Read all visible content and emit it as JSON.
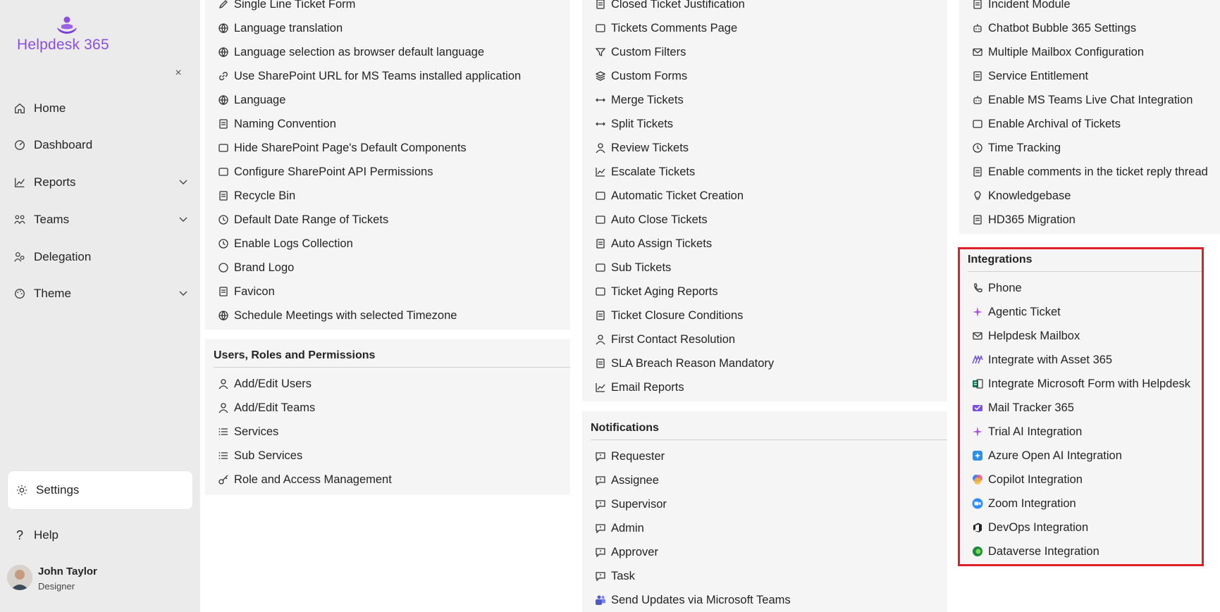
{
  "app": {
    "name": "Helpdesk 365"
  },
  "sidebar": {
    "close_label": "×",
    "nav": [
      {
        "label": "Home",
        "icon": "home-icon"
      },
      {
        "label": "Dashboard",
        "icon": "dashboard-icon"
      },
      {
        "label": "Reports",
        "icon": "chart-icon",
        "expandable": true
      },
      {
        "label": "Teams",
        "icon": "teams-icon",
        "expandable": true
      },
      {
        "label": "Delegation",
        "icon": "delegation-icon"
      },
      {
        "label": "Theme",
        "icon": "theme-icon",
        "expandable": true
      }
    ],
    "settings_label": "Settings",
    "help_label": "Help",
    "user": {
      "name": "John Taylor",
      "role": "Designer"
    }
  },
  "columns": {
    "col1_top": [
      "Single Line Ticket Form",
      "Language translation",
      "Language selection as browser default language",
      "Use SharePoint URL for MS Teams installed application",
      "Language",
      "Naming Convention",
      "Hide SharePoint Page's Default Components",
      "Configure SharePoint API Permissions",
      "Recycle Bin",
      "Default Date Range of Tickets",
      "Enable Logs Collection",
      "Brand Logo",
      "Favicon",
      "Schedule Meetings with selected Timezone"
    ],
    "users_roles": {
      "title": "Users, Roles and Permissions",
      "items": [
        "Add/Edit Users",
        "Add/Edit Teams",
        "Services",
        "Sub Services",
        "Role and Access Management"
      ]
    },
    "col2_top": [
      "Closed Ticket Justification",
      "Tickets Comments Page",
      "Custom Filters",
      "Custom Forms",
      "Merge Tickets",
      "Split Tickets",
      "Review Tickets",
      "Escalate Tickets",
      "Automatic Ticket Creation",
      "Auto Close Tickets",
      "Auto Assign Tickets",
      "Sub Tickets",
      "Ticket Aging Reports",
      "Ticket Closure Conditions",
      "First Contact Resolution",
      "SLA Breach Reason Mandatory",
      "Email Reports"
    ],
    "notifications": {
      "title": "Notifications",
      "items": [
        "Requester",
        "Assignee",
        "Supervisor",
        "Admin",
        "Approver",
        "Task",
        "Send Updates via Microsoft Teams"
      ]
    },
    "col3_top": [
      "Incident Module",
      "Chatbot Bubble 365 Settings",
      "Multiple Mailbox Configuration",
      "Service Entitlement",
      "Enable MS Teams Live Chat Integration",
      "Enable Archival of Tickets",
      "Time Tracking",
      "Enable comments in the ticket reply thread",
      "Knowledgebase",
      "HD365 Migration"
    ],
    "integrations": {
      "title": "Integrations",
      "items": [
        "Phone",
        "Agentic Ticket",
        "Helpdesk Mailbox",
        "Integrate with Asset 365",
        "Integrate Microsoft Form with Helpdesk",
        "Mail Tracker 365",
        "Trial AI Integration",
        "Azure Open AI Integration",
        "Copilot Integration",
        "Zoom Integration",
        "DevOps Integration",
        "Dataverse Integration"
      ]
    }
  },
  "colors": {
    "brand": "#8a4fe0",
    "highlight": "#e01f2a",
    "panel": "#f5f5f5",
    "sidebar": "#ebebeb"
  }
}
